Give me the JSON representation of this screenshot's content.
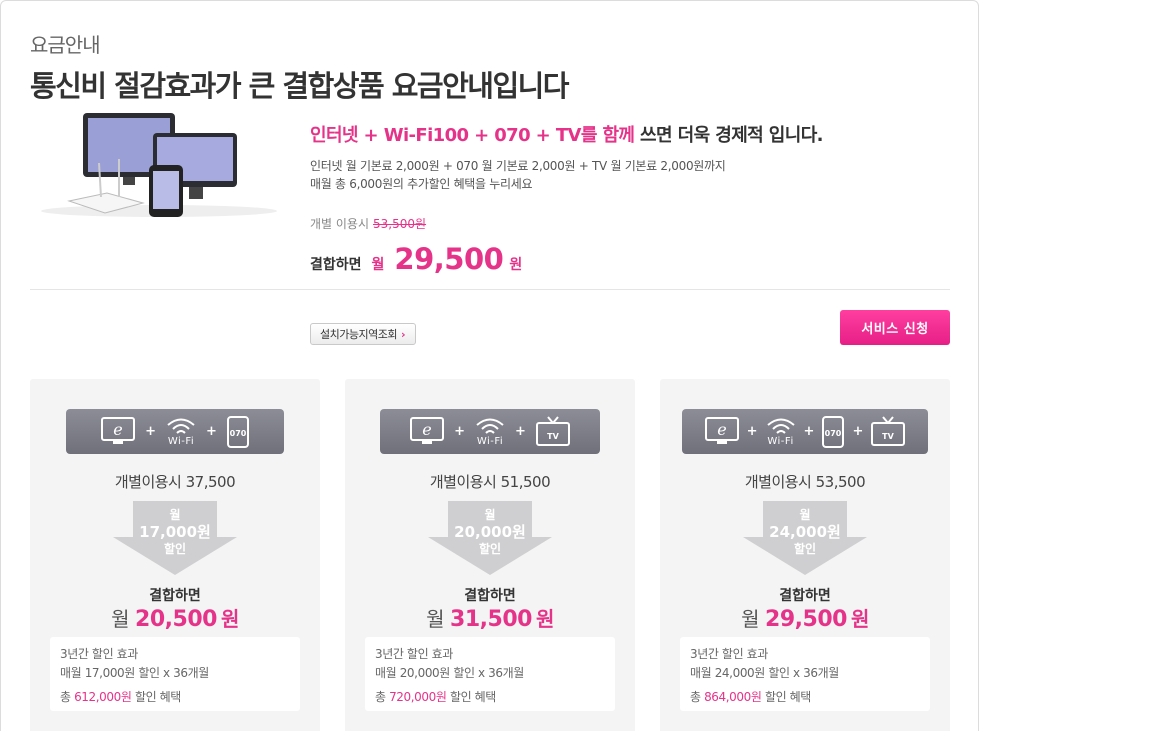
{
  "page": {
    "kicker": "요금안내",
    "headline": "통신비 절감효과가 큰 결합상품 요금안내입니다"
  },
  "promo": {
    "line_pink": "인터넷 + Wi-Fi100 + 070 + TV를 함께",
    "line_dark": " 쓰면 더욱 경제적 입니다.",
    "desc_line1": "인터넷 월 기본료 2,000원 + 070 월 기본료 2,000원 + TV 월 기본료 2,000원까지",
    "desc_line2": "매월 총 6,000원의 추가할인 혜택을 누리세요",
    "indiv_label": "개별 이용시",
    "indiv_price": "53,500원",
    "combined_label": "결합하면",
    "month_label": "월",
    "combined_price": "29,500",
    "won_label": "원"
  },
  "actions": {
    "area_check_label": "설치가능지역조회",
    "apply_label": "서비스 신청"
  },
  "colors": {
    "accent": "#e6338a",
    "bar": "#7d7e88",
    "card_bg": "#f4f4f4"
  },
  "cards": [
    {
      "icons": [
        "internet-icon",
        "wifi-icon",
        "phone-070-icon"
      ],
      "wifi_text": "Wi-Fi",
      "phone_text": "070",
      "indiv_text": "개별이용시  37,500",
      "discount_month": "월",
      "discount_amount": "17,000원",
      "discount_label": "할인",
      "combined_label": "결합하면",
      "price_month": "월",
      "price": "20,500",
      "price_won": "원",
      "detail_title": "3년간 할인 효과",
      "detail_calc": "매월 17,000원 할인 x 36개월",
      "detail_total_prefix": "총 ",
      "detail_total_amount": "612,000원",
      "detail_total_suffix": " 할인 혜택"
    },
    {
      "icons": [
        "internet-icon",
        "wifi-icon",
        "tv-icon"
      ],
      "wifi_text": "Wi-Fi",
      "tv_text": "TV",
      "indiv_text": "개별이용시  51,500",
      "discount_month": "월",
      "discount_amount": "20,000원",
      "discount_label": "할인",
      "combined_label": "결합하면",
      "price_month": "월",
      "price": "31,500",
      "price_won": "원",
      "detail_title": "3년간 할인 효과",
      "detail_calc": "매월 20,000원 할인 x 36개월",
      "detail_total_prefix": "총 ",
      "detail_total_amount": "720,000원",
      "detail_total_suffix": " 할인 혜택"
    },
    {
      "icons": [
        "internet-icon",
        "wifi-icon",
        "phone-070-icon",
        "tv-icon"
      ],
      "wifi_text": "Wi-Fi",
      "phone_text": "070",
      "tv_text": "TV",
      "indiv_text": "개별이용시  53,500",
      "discount_month": "월",
      "discount_amount": "24,000원",
      "discount_label": "할인",
      "combined_label": "결합하면",
      "price_month": "월",
      "price": "29,500",
      "price_won": "원",
      "detail_title": "3년간 할인 효과",
      "detail_calc": "매월 24,000원 할인 x 36개월",
      "detail_total_prefix": "총 ",
      "detail_total_amount": "864,000원",
      "detail_total_suffix": " 할인 혜택"
    }
  ]
}
